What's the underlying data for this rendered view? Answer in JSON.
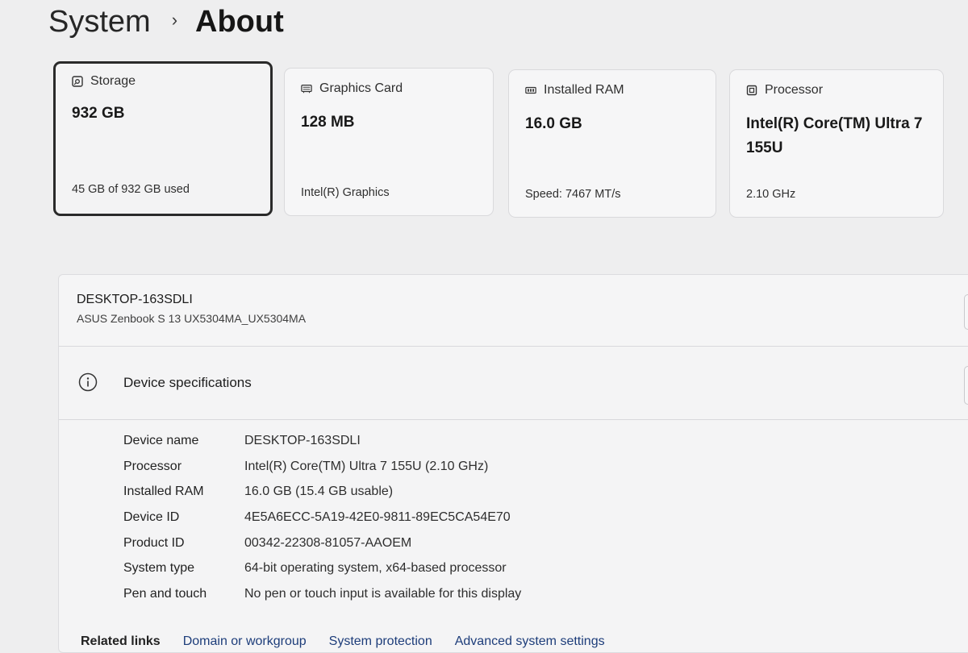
{
  "breadcrumb": {
    "parent": "System",
    "separator": "›",
    "current": "About"
  },
  "cards": [
    {
      "icon": "storage-icon",
      "label": "Storage",
      "value": "932 GB",
      "sub": "45 GB of 932 GB used"
    },
    {
      "icon": "graphics-card-icon",
      "label": "Graphics Card",
      "value": "128 MB",
      "sub": "Intel(R) Graphics"
    },
    {
      "icon": "ram-icon",
      "label": "Installed RAM",
      "value": "16.0 GB",
      "sub": "Speed: 7467 MT/s"
    },
    {
      "icon": "processor-icon",
      "label": "Processor",
      "value": "Intel(R) Core(TM) Ultra 7 155U",
      "sub": "2.10 GHz"
    }
  ],
  "device": {
    "name": "DESKTOP-163SDLI",
    "model": "ASUS Zenbook S 13 UX5304MA_UX5304MA"
  },
  "specs": {
    "title": "Device specifications",
    "rows": [
      {
        "label": "Device name",
        "value": "DESKTOP-163SDLI"
      },
      {
        "label": "Processor",
        "value": "Intel(R) Core(TM) Ultra 7 155U (2.10 GHz)"
      },
      {
        "label": "Installed RAM",
        "value": "16.0 GB (15.4 GB usable)"
      },
      {
        "label": "Device ID",
        "value": "4E5A6ECC-5A19-42E0-9811-89EC5CA54E70"
      },
      {
        "label": "Product ID",
        "value": "00342-22308-81057-AAOEM"
      },
      {
        "label": "System type",
        "value": "64-bit operating system, x64-based processor"
      },
      {
        "label": "Pen and touch",
        "value": "No pen or touch input is available for this display"
      }
    ]
  },
  "related": {
    "title": "Related links",
    "links": [
      "Domain or workgroup",
      "System protection",
      "Advanced system settings"
    ]
  }
}
